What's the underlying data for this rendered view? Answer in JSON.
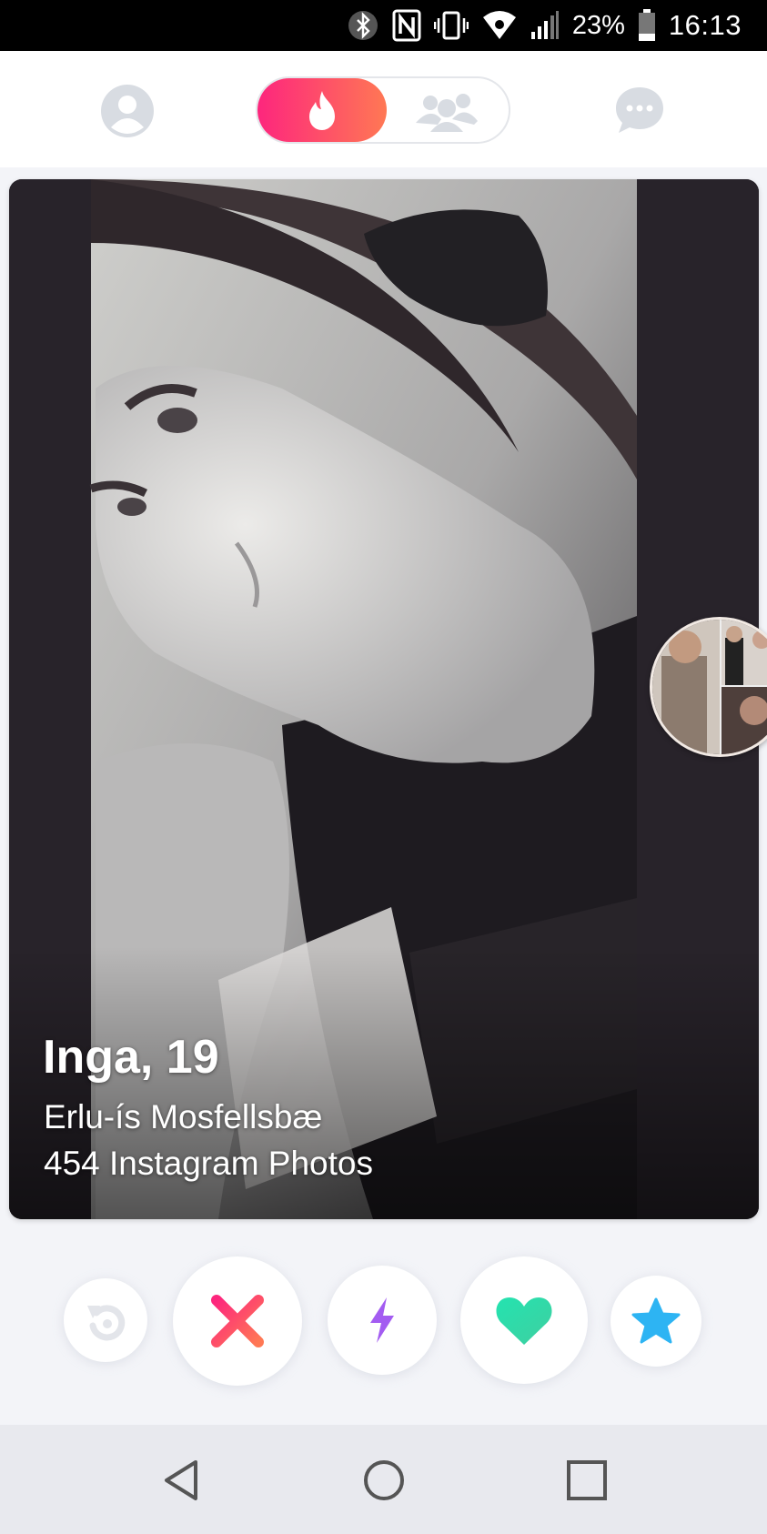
{
  "status_bar": {
    "battery": "23%",
    "time": "16:13",
    "icons": [
      "bluetooth-icon",
      "nfc-icon",
      "vibrate-icon",
      "wifi-icon",
      "signal-icon",
      "battery-icon"
    ]
  },
  "header": {
    "icons": [
      "profile-icon",
      "flame-icon",
      "social-group-icon",
      "chat-icon"
    ],
    "accent_gradient": [
      "#fd267d",
      "#ff7854"
    ]
  },
  "card": {
    "name_age": "Inga, 19",
    "school": "Erlu-ís Mosfellsbæ",
    "instagram": "454 Instagram Photos"
  },
  "actions": {
    "icons": [
      "rewind-icon",
      "nope-x-icon",
      "boost-bolt-icon",
      "like-heart-icon",
      "super-like-star-icon"
    ],
    "colors": {
      "rewind": "#e6e8ec",
      "nope": "#fd5068",
      "boost": "#a35cf1",
      "like": "#2ed7a3",
      "super_like": "#2db4f3"
    }
  },
  "navbar": {
    "icons": [
      "back-triangle-icon",
      "home-circle-icon",
      "recent-square-icon"
    ]
  }
}
